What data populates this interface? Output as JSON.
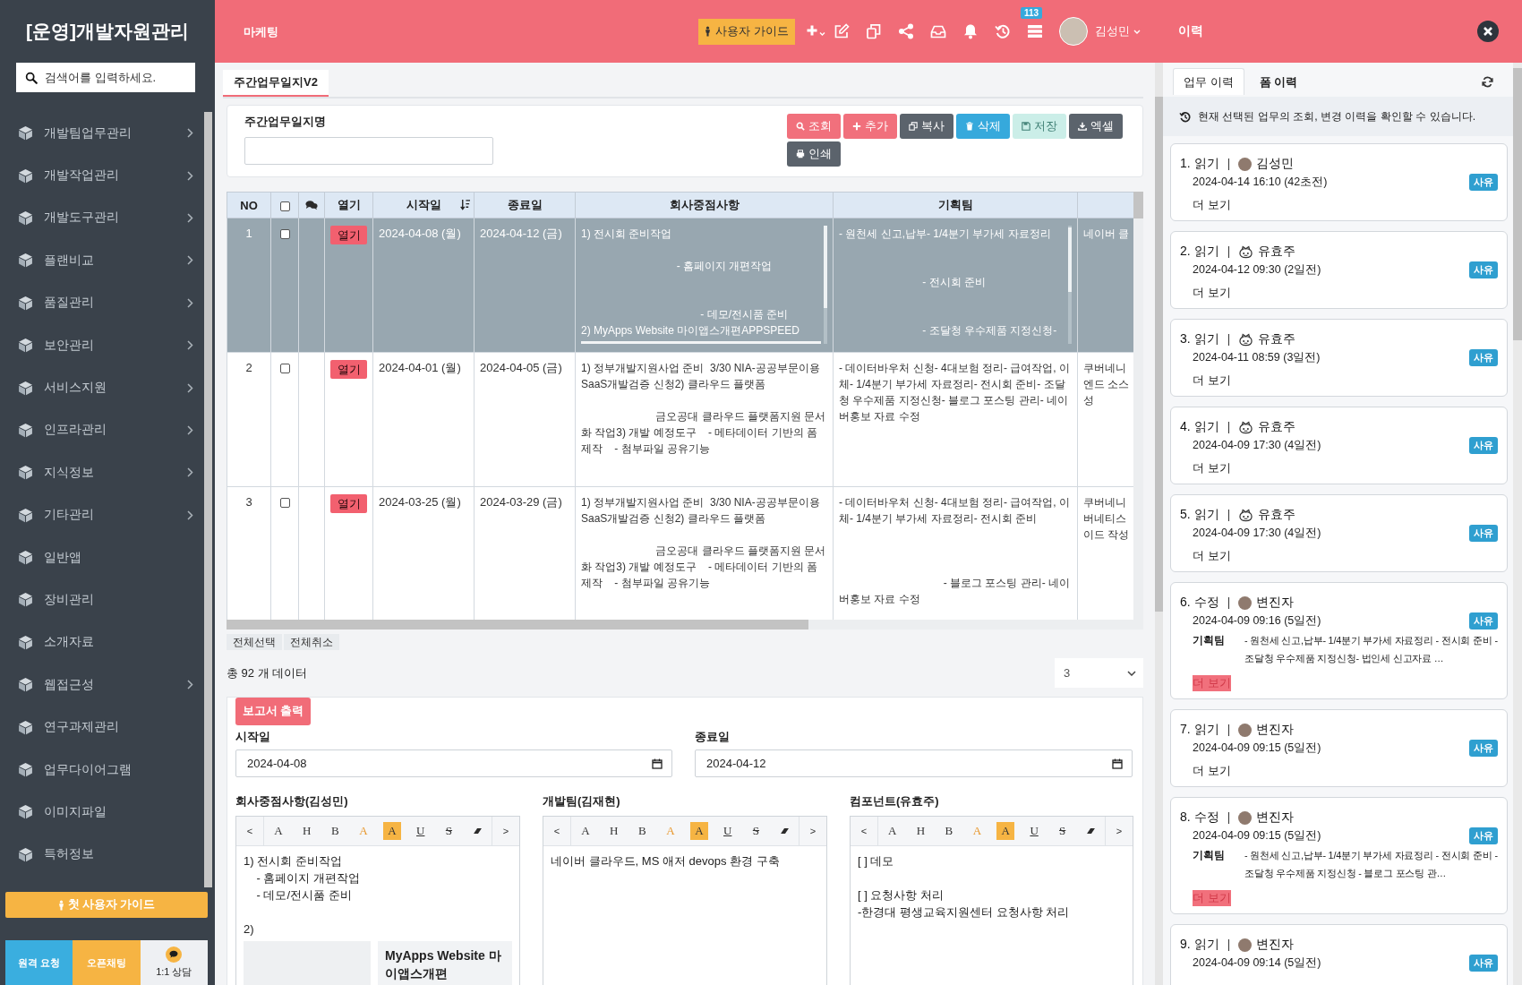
{
  "sidebar": {
    "title": "[운영]개발자원관리",
    "search": {
      "placeholder": "검색어를 입력하세요."
    },
    "items": [
      {
        "label": "개발팀업무관리",
        "has_children": true
      },
      {
        "label": "개발작업관리",
        "has_children": true
      },
      {
        "label": "개발도구관리",
        "has_children": true
      },
      {
        "label": "플랜비교",
        "has_children": true
      },
      {
        "label": "품질관리",
        "has_children": true
      },
      {
        "label": "보안관리",
        "has_children": true
      },
      {
        "label": "서비스지원",
        "has_children": true
      },
      {
        "label": "인프라관리",
        "has_children": true
      },
      {
        "label": "지식정보",
        "has_children": true
      },
      {
        "label": "기타관리",
        "has_children": true
      },
      {
        "label": "일반앱",
        "has_children": false
      },
      {
        "label": "장비관리",
        "has_children": false
      },
      {
        "label": "소개자료",
        "has_children": false
      },
      {
        "label": "웹접근성",
        "has_children": true
      },
      {
        "label": "연구과제관리",
        "has_children": false
      },
      {
        "label": "업무다이어그램",
        "has_children": false
      },
      {
        "label": "이미지파일",
        "has_children": false
      },
      {
        "label": "특허정보",
        "has_children": false
      }
    ],
    "guide_button": "첫 사용자 가이드",
    "footer_buttons": [
      {
        "label": "원격 요청",
        "kind": "remote"
      },
      {
        "label": "오픈채팅",
        "kind": "chat"
      },
      {
        "label": "1:1 상담",
        "kind": "consult"
      }
    ]
  },
  "header": {
    "menu_title": "마케팅",
    "guide_button": "사용자 가이드",
    "notification_count": "113",
    "user_name": "김성민",
    "panel_title": "이력"
  },
  "tabs": [
    {
      "label": "주간업무일지V2",
      "selected": true
    }
  ],
  "search_panel": {
    "field_label": "주간업무일지명",
    "buttons": [
      {
        "label": "조회",
        "kind": "search",
        "disabled": false
      },
      {
        "label": "추가",
        "kind": "add",
        "disabled": false
      },
      {
        "label": "복사",
        "kind": "copy",
        "disabled": false
      },
      {
        "label": "삭제",
        "kind": "delete",
        "disabled": false
      },
      {
        "label": "저장",
        "kind": "save",
        "disabled": true
      },
      {
        "label": "엑셀",
        "kind": "excel",
        "disabled": false
      },
      {
        "label": "인쇄",
        "kind": "print",
        "disabled": false
      }
    ]
  },
  "table": {
    "columns": [
      {
        "kind": "text",
        "label": "NO",
        "sorted": false
      },
      {
        "kind": "checkbox",
        "checked": false
      },
      {
        "kind": "comment"
      },
      {
        "kind": "text",
        "label": "열기",
        "sorted": false
      },
      {
        "kind": "text",
        "label": "시작일",
        "sorted": true
      },
      {
        "kind": "text",
        "label": "종료일",
        "sorted": false
      },
      {
        "kind": "text",
        "label": "회사중점사항",
        "sorted": false
      },
      {
        "kind": "text",
        "label": "기획팀",
        "sorted": false
      },
      {
        "kind": "blank"
      }
    ],
    "rows": [
      {
        "no": "1",
        "checked": false,
        "selected": true,
        "open_button": "열기",
        "start_date": "2024-04-08 (월)",
        "end_date": "2024-04-12 (금)",
        "company_focus": "1) 전시회 준비작업\n\n                                - 홈페이지 개편작업\n\n\n                                        - 데모/전시품 준비\n2) MyApps Website 마이앱스개편APPSPEED",
        "planning_team": "- 원천세 신고,납부- 1/4분기 부가세 자료정리\n\n\n                            - 전시회 준비\n\n\n                            - 조달청 우수제품 지정신청-",
        "column_9": [
          "네이버 클"
        ]
      },
      {
        "no": "2",
        "checked": false,
        "selected": false,
        "open_button": "열기",
        "start_date": "2024-04-01 (월)",
        "end_date": "2024-04-05 (금)",
        "company_focus": "1) 정부개발지원사업 준비  3/30 NIA-공공부문이용SaaS개발검증 신청2) 클라우드 플랫폼\n\n                         금오공대 클라우드 플랫폼지원 문서화 작업3) 개발 예정도구    - 메타데이터 기반의 폼 제작    - 첨부파일 공유기능",
        "planning_team": "- 데이터바우처 신청- 4대보험 정리- 급여작업, 이체- 1/4분기 부가세 자료정리- 전시회 준비- 조달청 우수제품 지정신청- 블로그 포스팅 관리- 네이버홍보 자료 수정",
        "column_9": [
          "쿠버네니",
          "엔드 소스",
          "성"
        ]
      },
      {
        "no": "3",
        "checked": false,
        "selected": false,
        "open_button": "열기",
        "start_date": "2024-03-25 (월)",
        "end_date": "2024-03-29 (금)",
        "company_focus": "1) 정부개발지원사업 준비  3/30 NIA-공공부문이용SaaS개발검증 신청2) 클라우드 플랫폼\n\n                         금오공대 클라우드 플랫폼지원 문서화 작업3) 개발 예정도구    - 메타데이터 기반의 폼 제작    - 첨부파일 공유기능",
        "planning_team": "- 데이터바우처 신청- 4대보험 정리- 급여작업, 이체- 1/4분기 부가세 자료정리- 전시회 준비\n\n\n\n                                   - 블로그 포스팅 관리- 네이버홍보 자료 수정",
        "column_9": [
          "쿠버네니",
          "버네티스",
          "이드 작성"
        ]
      }
    ]
  },
  "bulk_actions": [
    "전체선택",
    "전체취소"
  ],
  "total": "총 92 개 데이터",
  "page_size": "3",
  "report": {
    "print_button": "보고서 출력",
    "start_label": "시작일",
    "start_value": "2024-04-08",
    "end_label": "종료일",
    "end_value": "2024-04-12",
    "editors": [
      {
        "label": "회사중점사항(김성민)",
        "toolbar": [
          {
            "kind": "prev",
            "label": "<"
          },
          {
            "kind": "font",
            "label": "A"
          },
          {
            "kind": "heading",
            "label": "H"
          },
          {
            "kind": "bold",
            "label": "B"
          },
          {
            "kind": "color",
            "label": "A"
          },
          {
            "kind": "highlight",
            "label": "A"
          },
          {
            "kind": "underline",
            "label": "U"
          },
          {
            "kind": "strike",
            "label": "S"
          },
          {
            "kind": "eraser"
          },
          {
            "kind": "next",
            "label": ">"
          }
        ],
        "content": "1) 전시회 준비작업\n    - 홈페이지 개편작업\n    - 데모/전시품 준비\n\n2)",
        "link_preview": {
          "title": "MyApps Website 마이앱스개편"
        }
      },
      {
        "label": "개발팀(김재현)",
        "toolbar": [
          {
            "kind": "prev",
            "label": "<"
          },
          {
            "kind": "font",
            "label": "A"
          },
          {
            "kind": "heading",
            "label": "H"
          },
          {
            "kind": "bold",
            "label": "B"
          },
          {
            "kind": "color",
            "label": "A"
          },
          {
            "kind": "highlight",
            "label": "A"
          },
          {
            "kind": "underline",
            "label": "U"
          },
          {
            "kind": "strike",
            "label": "S"
          },
          {
            "kind": "eraser"
          },
          {
            "kind": "next",
            "label": ">"
          }
        ],
        "content": "네이버 클라우드, MS 애저 devops 환경 구축"
      },
      {
        "label": "컴포넌트(유효주)",
        "toolbar": [
          {
            "kind": "prev",
            "label": "<"
          },
          {
            "kind": "font",
            "label": "A"
          },
          {
            "kind": "heading",
            "label": "H"
          },
          {
            "kind": "bold",
            "label": "B"
          },
          {
            "kind": "color",
            "label": "A"
          },
          {
            "kind": "highlight",
            "label": "A"
          },
          {
            "kind": "underline",
            "label": "U"
          },
          {
            "kind": "strike",
            "label": "S"
          },
          {
            "kind": "eraser"
          },
          {
            "kind": "next",
            "label": ">"
          }
        ],
        "content": "[ ] 데모\n\n[ ] 요청사항 처리\n-한경대 평생교육지원센터 요청사항 처리"
      }
    ]
  },
  "history_panel": {
    "tabs": [
      {
        "label": "업무 이력",
        "selected": true
      },
      {
        "label": "폼 이력",
        "selected": false
      }
    ],
    "info": "현재 선택된 업무의 조회, 변경 이력을 확인할 수 있습니다.",
    "cards": [
      {
        "title": "1. 읽기",
        "kind": "read",
        "avatar": {
          "kind": "photo"
        },
        "user": "김성민",
        "time": "2024-04-14 16:10 (42초전)",
        "badge": "사유",
        "more": "더 보기"
      },
      {
        "title": "2. 읽기",
        "kind": "read",
        "avatar": {
          "kind": "emblem"
        },
        "user": "유효주",
        "time": "2024-04-12 09:30 (2일전)",
        "badge": "사유",
        "more": "더 보기"
      },
      {
        "title": "3. 읽기",
        "kind": "read",
        "avatar": {
          "kind": "emblem"
        },
        "user": "유효주",
        "time": "2024-04-11 08:59 (3일전)",
        "badge": "사유",
        "more": "더 보기"
      },
      {
        "title": "4. 읽기",
        "kind": "read",
        "avatar": {
          "kind": "emblem"
        },
        "user": "유효주",
        "time": "2024-04-09 17:30 (4일전)",
        "badge": "사유",
        "more": "더 보기"
      },
      {
        "title": "5. 읽기",
        "kind": "read",
        "avatar": {
          "kind": "emblem"
        },
        "user": "유효주",
        "time": "2024-04-09 17:30 (4일전)",
        "badge": "사유",
        "more": "더 보기"
      },
      {
        "title": "6. 수정",
        "kind": "edit",
        "avatar": {
          "kind": "photo"
        },
        "user": "변진자",
        "time": "2024-04-09 09:16 (5일전)",
        "badge": "사유",
        "team": "기획팀",
        "summary": "- 원천세 신고,납부- 1/4분기 부가세 자료정리 - 전시회 준비 - 조달청 우수제품 지정신청- 법인세 신고자료 …",
        "more": "더 보기"
      },
      {
        "title": "7. 읽기",
        "kind": "read",
        "avatar": {
          "kind": "photo"
        },
        "user": "변진자",
        "time": "2024-04-09 09:15 (5일전)",
        "badge": "사유",
        "more": "더 보기"
      },
      {
        "title": "8. 수정",
        "kind": "edit",
        "avatar": {
          "kind": "photo"
        },
        "user": "변진자",
        "time": "2024-04-09 09:15 (5일전)",
        "badge": "사유",
        "team": "기획팀",
        "summary": "- 원천세 신고,납부- 1/4분기 부가세 자료정리 - 전시회 준비 - 조달청 우수제품 지정신청 - 블로그 포스팅 관…",
        "more": "더 보기"
      },
      {
        "title": "9. 읽기",
        "avatar": {
          "kind": "photo"
        },
        "user": "변진자",
        "time": "2024-04-09 09:14 (5일전)",
        "badge": "사유"
      }
    ]
  }
}
